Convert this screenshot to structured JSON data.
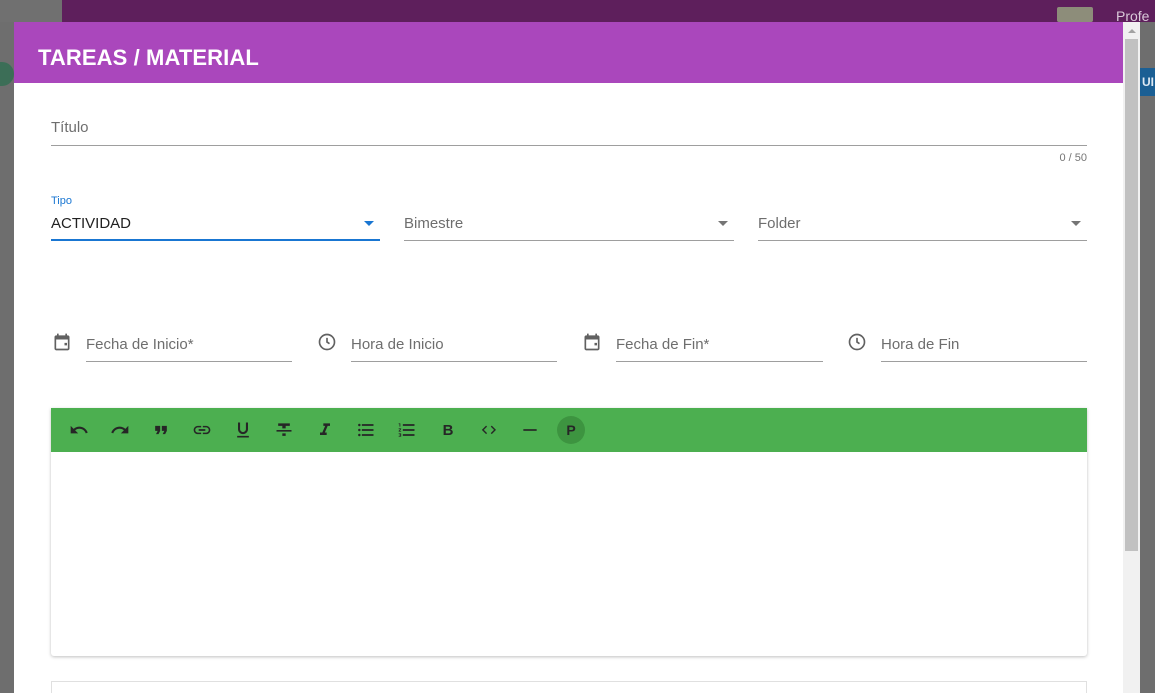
{
  "background": {
    "profile_text": "Profe",
    "side_button_text": "UI"
  },
  "dialog": {
    "title": "TAREAS / MATERIAL",
    "header_color": "#aa47bc"
  },
  "form": {
    "titulo": {
      "label": "Título",
      "counter": "0 / 50"
    },
    "tipo": {
      "label": "Tipo",
      "value": "ACTIVIDAD"
    },
    "bimestre": {
      "placeholder": "Bimestre"
    },
    "folder": {
      "placeholder": "Folder"
    },
    "fecha_inicio": {
      "label": "Fecha de Inicio*",
      "icon": "calendar-icon"
    },
    "hora_inicio": {
      "label": "Hora de Inicio",
      "icon": "clock-icon"
    },
    "fecha_fin": {
      "label": "Fecha de Fin*",
      "icon": "calendar-icon"
    },
    "hora_fin": {
      "label": "Hora de Fin",
      "icon": "clock-icon"
    }
  },
  "editor": {
    "toolbar_color": "#4caf50",
    "toolbar": {
      "undo": "undo-icon",
      "redo": "redo-icon",
      "quote": "quote-icon",
      "link": "link-icon",
      "underline": "underline-icon",
      "strike": "strikethrough-icon",
      "italic": "italic-icon",
      "bullet_list": "bulleted-list-icon",
      "ordered_list": "numbered-list-icon",
      "bold_label": "B",
      "code": "code-icon",
      "hr": "horizontal-rule-icon",
      "paragraph_label": "P"
    }
  }
}
